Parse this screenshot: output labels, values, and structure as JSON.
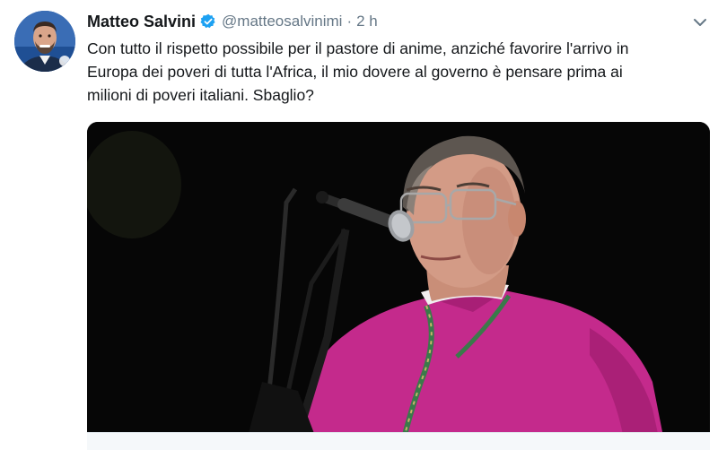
{
  "tweet": {
    "author_name": "Matteo Salvini",
    "handle": "@matteosalvinimi",
    "separator": "·",
    "time": "2 h",
    "text_lines": [
      "Con tutto il rispetto possibile per il pastore di anime, anziché favorire l'arrivo in",
      "Europa dei poveri di tutta l'Africa, il mio dovere al governo è pensare prima ai",
      "milioni di poveri italiani. Sbaglio?"
    ],
    "verified": true
  },
  "icons": {
    "verified": "verified-badge-icon",
    "caret": "chevron-down-icon"
  },
  "colors": {
    "verified_blue": "#1da1f2",
    "secondary_text": "#657786",
    "vestment_magenta": "#c42a8c"
  }
}
